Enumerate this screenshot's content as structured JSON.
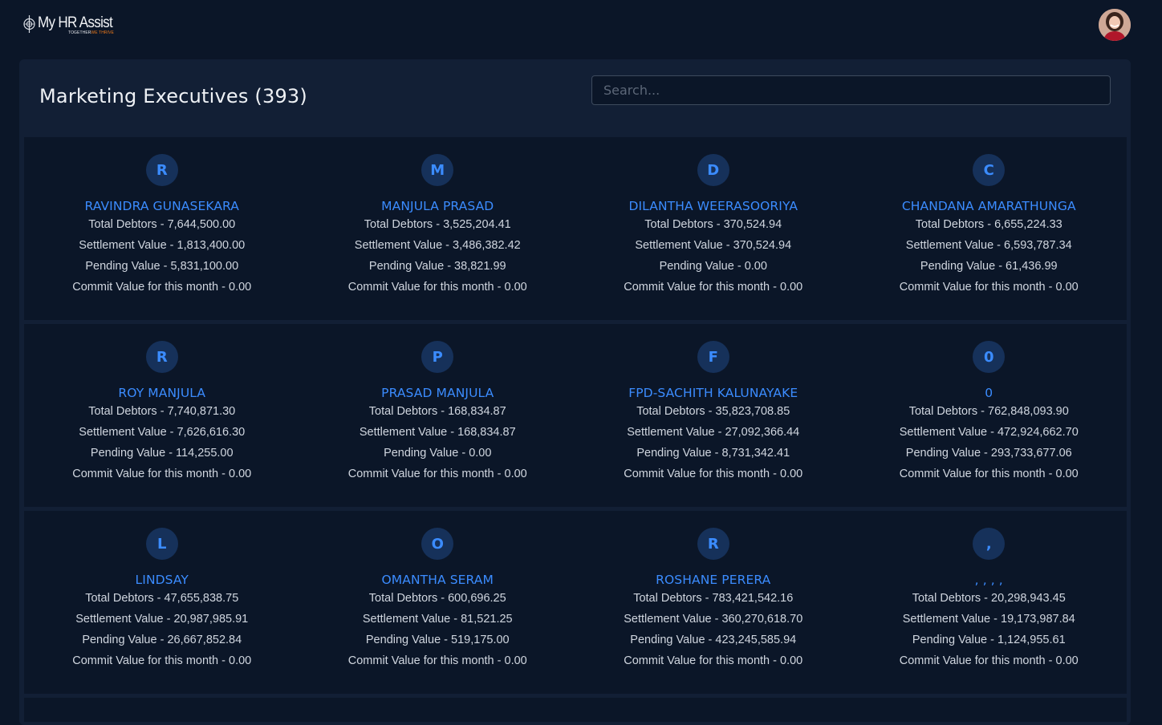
{
  "app": {
    "logo_title": "My HR Assist",
    "logo_tagline_a": "TOGETHER",
    "logo_tagline_b": "WE THRIVE",
    "accent_color": "#f07a1a"
  },
  "header": {
    "title": "Marketing Executives (393)",
    "search_placeholder": "Search..."
  },
  "colors": {
    "background": "#0b1628",
    "panel": "#121f35",
    "name_blue": "#3b8cff",
    "initial_bg": "#16315a"
  },
  "rows": [
    [
      {
        "initial": "R",
        "name": "RAVINDRA GUNASEKARA",
        "total": "Total Debtors - 7,644,500.00",
        "settlement": "Settlement Value - 1,813,400.00",
        "pending": "Pending Value - 5,831,100.00",
        "commit": "Commit Value for this month - 0.00"
      },
      {
        "initial": "M",
        "name": "MANJULA PRASAD",
        "total": "Total Debtors - 3,525,204.41",
        "settlement": "Settlement Value - 3,486,382.42",
        "pending": "Pending Value - 38,821.99",
        "commit": "Commit Value for this month - 0.00"
      },
      {
        "initial": "D",
        "name": "DILANTHA WEERASOORIYA",
        "total": "Total Debtors - 370,524.94",
        "settlement": "Settlement Value - 370,524.94",
        "pending": "Pending Value - 0.00",
        "commit": "Commit Value for this month - 0.00"
      },
      {
        "initial": "C",
        "name": "CHANDANA AMARATHUNGA",
        "total": "Total Debtors - 6,655,224.33",
        "settlement": "Settlement Value - 6,593,787.34",
        "pending": "Pending Value - 61,436.99",
        "commit": "Commit Value for this month - 0.00"
      }
    ],
    [
      {
        "initial": "R",
        "name": "ROY MANJULA",
        "total": "Total Debtors - 7,740,871.30",
        "settlement": "Settlement Value - 7,626,616.30",
        "pending": "Pending Value - 114,255.00",
        "commit": "Commit Value for this month - 0.00"
      },
      {
        "initial": "P",
        "name": "PRASAD MANJULA",
        "total": "Total Debtors - 168,834.87",
        "settlement": "Settlement Value - 168,834.87",
        "pending": "Pending Value - 0.00",
        "commit": "Commit Value for this month - 0.00"
      },
      {
        "initial": "F",
        "name": "FPD-SACHITH KALUNAYAKE",
        "total": "Total Debtors - 35,823,708.85",
        "settlement": "Settlement Value - 27,092,366.44",
        "pending": "Pending Value - 8,731,342.41",
        "commit": "Commit Value for this month - 0.00"
      },
      {
        "initial": "0",
        "name": "0",
        "total": "Total Debtors - 762,848,093.90",
        "settlement": "Settlement Value - 472,924,662.70",
        "pending": "Pending Value - 293,733,677.06",
        "commit": "Commit Value for this month - 0.00"
      }
    ],
    [
      {
        "initial": "L",
        "name": "LINDSAY",
        "total": "Total Debtors - 47,655,838.75",
        "settlement": "Settlement Value - 20,987,985.91",
        "pending": "Pending Value - 26,667,852.84",
        "commit": "Commit Value for this month - 0.00"
      },
      {
        "initial": "O",
        "name": "OMANTHA SERAM",
        "total": "Total Debtors - 600,696.25",
        "settlement": "Settlement Value - 81,521.25",
        "pending": "Pending Value - 519,175.00",
        "commit": "Commit Value for this month - 0.00"
      },
      {
        "initial": "R",
        "name": "ROSHANE PERERA",
        "total": "Total Debtors - 783,421,542.16",
        "settlement": "Settlement Value - 360,270,618.70",
        "pending": "Pending Value - 423,245,585.94",
        "commit": "Commit Value for this month - 0.00"
      },
      {
        "initial": ",",
        "name": ", , , ,",
        "total": "Total Debtors - 20,298,943.45",
        "settlement": "Settlement Value - 19,173,987.84",
        "pending": "Pending Value - 1,124,955.61",
        "commit": "Commit Value for this month - 0.00"
      }
    ]
  ]
}
